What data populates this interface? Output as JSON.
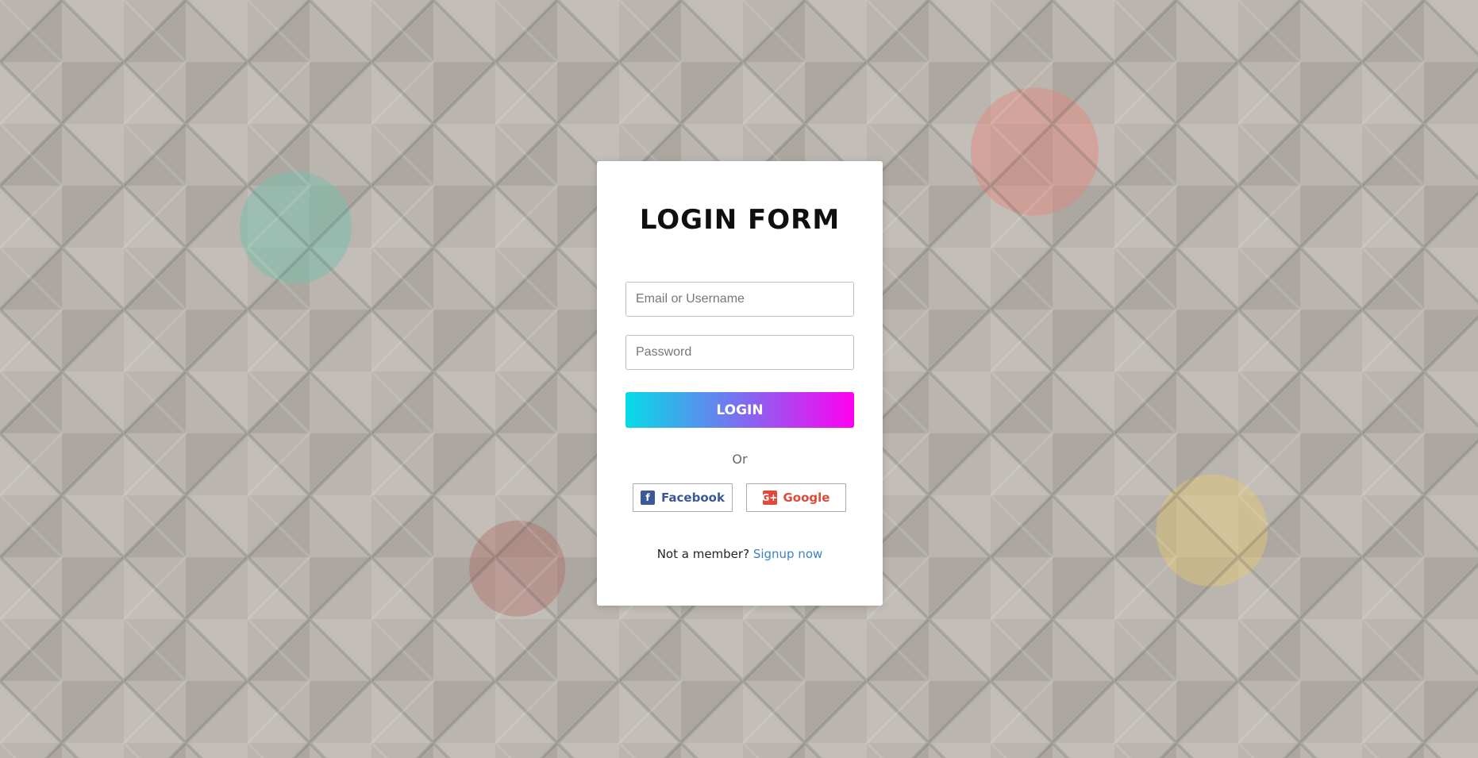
{
  "login_form": {
    "title": "LOGIN FORM",
    "email_placeholder": "Email or Username",
    "password_placeholder": "Password",
    "login_button": "LOGIN",
    "or_text": "Or",
    "facebook_label": "Facebook",
    "google_label": "Google",
    "signup_prompt": "Not a member?",
    "signup_link": "Signup now"
  },
  "icons": {
    "facebook": "facebook-icon",
    "google": "google-plus-icon"
  },
  "colors": {
    "button_gradient_start": "#05dce6",
    "button_gradient_end": "#ff00f0",
    "facebook": "#3b5998",
    "google": "#dd4b39",
    "link": "#3b82c4"
  }
}
